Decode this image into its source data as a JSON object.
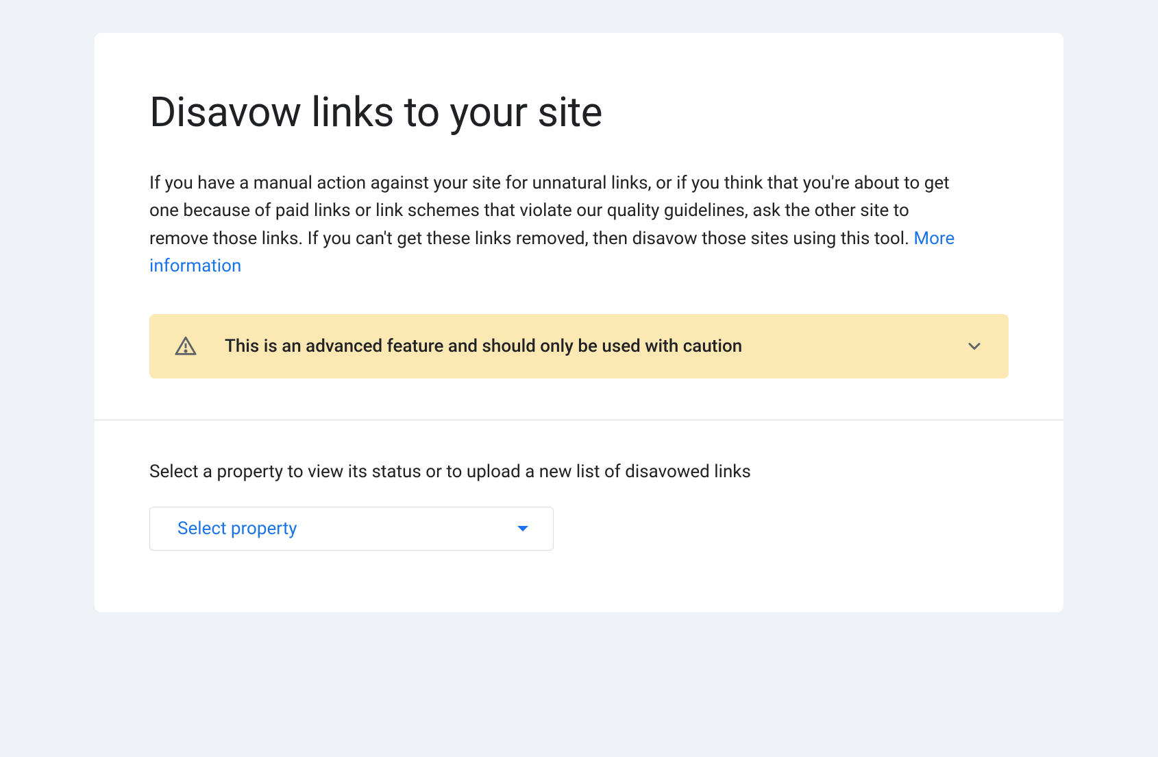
{
  "header": {
    "title": "Disavow links to your site"
  },
  "description": {
    "text": "If you have a manual action against your site for unnatural links, or if you think that you're about to get one because of paid links or link schemes that violate our quality guidelines, ask the other site to remove those links. If you can't get these links removed, then disavow those sites using this tool. ",
    "link_text": "More information"
  },
  "warning": {
    "text": "This is an advanced feature and should only be used with caution"
  },
  "select": {
    "label": "Select a property to view its status or to upload a new list of disavowed links",
    "dropdown_label": "Select property"
  },
  "colors": {
    "background": "#eef1f6",
    "card": "#ffffff",
    "text": "#202124",
    "link": "#1a73e8",
    "warning_bg": "#fce8b2",
    "border": "#dadce0"
  }
}
